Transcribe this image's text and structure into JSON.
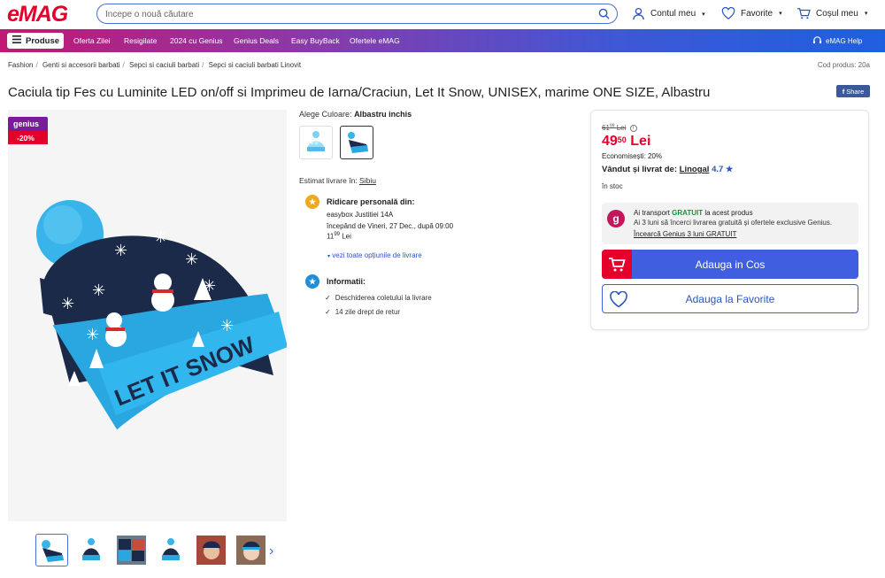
{
  "header": {
    "logo_text": "eMAG",
    "search_placeholder": "Începe o nouă căutare",
    "account_label": "Contul meu",
    "favorites_label": "Favorite",
    "cart_label": "Coșul meu"
  },
  "nav": {
    "produse_label": "Produse",
    "items": [
      "Oferta Zilei",
      "Resigilate",
      "2024 cu Genius",
      "Genius Deals",
      "Easy BuyBack",
      "Ofertele eMAG"
    ],
    "help_label": "eMAG Help"
  },
  "breadcrumbs": [
    "Fashion",
    "Genti si accesorii barbati",
    "Sepci si caciuli barbati",
    "Sepci si caciuli barbati Linovit"
  ],
  "product_code": "Cod produs: 20a",
  "title": "Caciula tip Fes cu Luminite LED on/off si Imprimeu de Iarna/Craciun, Let It Snow, UNISEX, marime ONE SIZE, Albastru",
  "share_label": "Share",
  "badge": {
    "genius": "genius",
    "discount": "-20%"
  },
  "image_text": "LET IT SNOW",
  "color": {
    "label": "Alege Culoare:",
    "value": "Albastru inchis"
  },
  "delivery": {
    "estimate_label": "Estimat livrare în:",
    "city": "Sibiu",
    "pickup_title": "Ridicare personală din:",
    "pickup_place": "easybox Justitiei 14A",
    "pickup_date": "începând de Vineri, 27 Dec., după 09:00",
    "pickup_price_int": "11",
    "pickup_price_dec": "99",
    "pickup_currency": "Lei",
    "more_options": "vezi toate opțiunile de livrare"
  },
  "info": {
    "title": "Informatii:",
    "items": [
      "Deschiderea coletului la livrare",
      "14 zile drept de retur"
    ]
  },
  "buybox": {
    "old_price_int": "61",
    "old_price_dec": "99",
    "old_currency": "Lei",
    "price_int": "49",
    "price_dec": "50",
    "currency": "Lei",
    "savings": "Economisești: 20%",
    "seller_label": "Vândut și livrat de:",
    "seller_name": "Linogal",
    "seller_rating": "4.7",
    "stock": "în stoc",
    "genius_line1_pre": "Ai transport",
    "genius_line1_free": "GRATUIT",
    "genius_line1_post": "la acest produs",
    "genius_line2": "Ai 3 luni să încerci livrarea gratuită și ofertele exclusive Genius.",
    "genius_line3": "Încearcă Genius 3 luni GRATUIT",
    "add_to_cart": "Adauga in Cos",
    "add_to_fav": "Adauga la Favorite"
  },
  "colors": {
    "brand_red": "#e4002b",
    "brand_blue": "#3f5ee0",
    "genius_purple": "#7a1b9a",
    "hat_navy": "#1c2a4a",
    "hat_cyan": "#2aa7e0"
  }
}
